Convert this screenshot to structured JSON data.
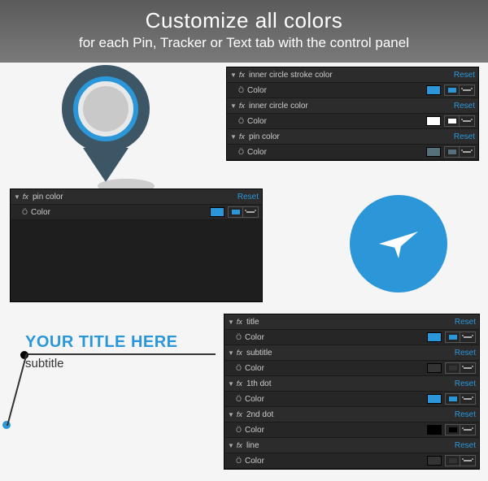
{
  "header": {
    "title": "Customize all colors",
    "subtitle": "for each Pin, Tracker or Text tab with the control panel"
  },
  "labels": {
    "reset": "Reset",
    "color_prop": "Color"
  },
  "panel1": {
    "effects": [
      {
        "name": "inner circle stroke color",
        "swatch": "#2c97d8",
        "mini": "#2c97d8"
      },
      {
        "name": "inner circle color",
        "swatch": "#ffffff",
        "mini": "#ffffff"
      },
      {
        "name": "pin color",
        "swatch": "#55707b",
        "mini": "#55707b"
      }
    ]
  },
  "panel2": {
    "effects": [
      {
        "name": "pin color",
        "swatch": "#2c97d8",
        "mini": "#2c97d8"
      }
    ]
  },
  "panel3": {
    "effects": [
      {
        "name": "title",
        "swatch": "#2c97d8",
        "mini": "#2c97d8"
      },
      {
        "name": "subtitle",
        "swatch": "#333333",
        "mini": "#333333"
      },
      {
        "name": "1th dot",
        "swatch": "#2c97d8",
        "mini": "#2c97d8"
      },
      {
        "name": "2nd dot",
        "swatch": "#000000",
        "mini": "#000000"
      },
      {
        "name": "line",
        "swatch": "#333333",
        "mini": "#333333"
      }
    ]
  },
  "preview": {
    "title": "YOUR TITLE HERE",
    "subtitle": "subtitle"
  }
}
